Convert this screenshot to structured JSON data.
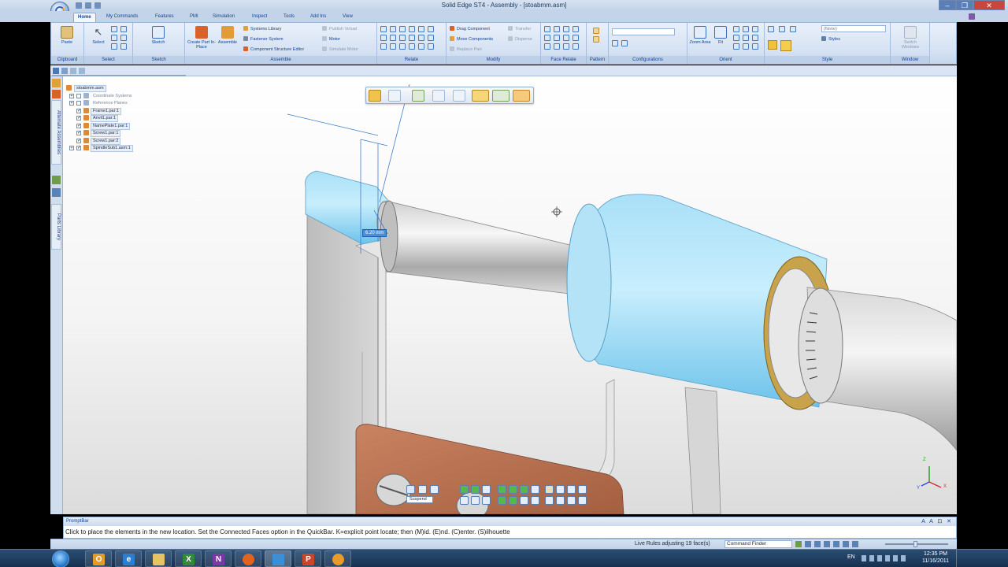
{
  "window": {
    "title": "Solid Edge ST4 - Assembly - [stoabmm.asm]",
    "controls": [
      "–",
      "❐",
      "✕"
    ]
  },
  "ribbon": {
    "tabs": [
      "Home",
      "My Commands",
      "Features",
      "PMI",
      "Simulation",
      "Inspect",
      "Tools",
      "Add Ins",
      "View"
    ],
    "active_tab": "Home",
    "groups": {
      "clipboard": {
        "label": "Clipboard",
        "paste": "Paste"
      },
      "select": {
        "label": "Select",
        "select": "Select"
      },
      "sketch": {
        "label": "Sketch",
        "sketch": "Sketch"
      },
      "assemble": {
        "label": "Assemble",
        "create_part": "Create Part In-Place",
        "assemble": "Assemble",
        "systems_library": "Systems Library",
        "fastener_system": "Fastener System",
        "component_structure_editor": "Component Structure Editor",
        "publish_virtual": "Publish Virtual",
        "motor": "Motor",
        "simulate_motor": "Simulate Motor"
      },
      "relate": {
        "label": "Relate"
      },
      "modify": {
        "label": "Modify",
        "drag_component": "Drag Component",
        "move_components": "Move Components",
        "replace_part": "Replace Part",
        "transfer": "Transfer",
        "disperse": "Disperse"
      },
      "face_relate": {
        "label": "Face Relate"
      },
      "pattern": {
        "label": "Pattern"
      },
      "configurations": {
        "label": "Configurations"
      },
      "orient": {
        "label": "Orient",
        "zoom_area": "Zoom Area",
        "fit": "Fit"
      },
      "style": {
        "label": "Style",
        "style_value": "(None)",
        "styles": "Styles"
      },
      "window": {
        "label": "Window",
        "switch_windows": "Switch Windows"
      }
    }
  },
  "dock_tabs": [
    "Alternate Assemblies",
    "Parts Library"
  ],
  "tree": {
    "root": "stoabmm.asm",
    "items": [
      {
        "label": "Coordinate Systems",
        "dim": true,
        "expandable": true
      },
      {
        "label": "Reference Planes",
        "dim": true,
        "expandable": true
      },
      {
        "label": "Frame1.par:1",
        "dim": false,
        "expandable": false
      },
      {
        "label": "Anvil1.par:1",
        "dim": false,
        "expandable": false
      },
      {
        "label": "NamePlate1.par:1",
        "dim": false,
        "expandable": false
      },
      {
        "label": "Screw1.par:1",
        "dim": false,
        "expandable": false
      },
      {
        "label": "Screw1.par:2",
        "dim": false,
        "expandable": false
      },
      {
        "label": "SpindleSub1.asm:1",
        "dim": false,
        "expandable": true
      }
    ]
  },
  "viewport": {
    "dimension_label": "6.20 mm",
    "suspend_label": "Suspend",
    "triad": {
      "x": "X",
      "y": "Y",
      "z": "Z"
    }
  },
  "prompt": {
    "header": "PromptBar",
    "text": "Click to place the elements in the new location.  Set the Connected Faces option in the QuickBar.  K=explicit point locate; then (M)id. (E)nd. (C)enter. (S)ilhouette"
  },
  "status": {
    "live_rules": "Live Rules adjusting 19 face(s)",
    "command_finder": "Command Finder"
  },
  "taskbar": {
    "language": "EN",
    "time": "12:35 PM",
    "date": "11/16/2011"
  },
  "colors": {
    "highlight_blue": "#8fd3f4",
    "nameplate": "#b86f4e",
    "frame_gray": "#d9d9d9"
  }
}
